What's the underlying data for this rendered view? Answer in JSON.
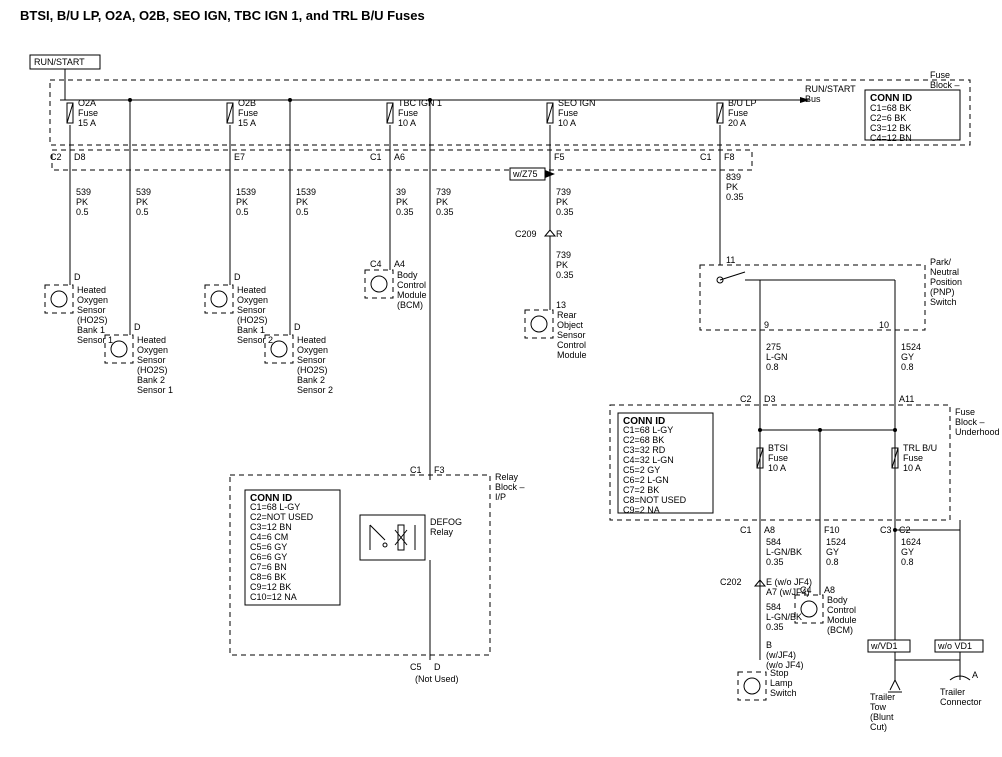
{
  "title": "BTSI, B/U LP, O2A, O2B, SEO IGN, TBC IGN 1, and TRL B/U Fuses",
  "runstart": "RUN/START",
  "runstart_bus": "RUN/START\nBus",
  "fuse_block_ip": "Fuse\nBlock –\nI/P",
  "fuse_block_uh": "Fuse\nBlock –\nUnderhood",
  "relay_block_ip": "Relay\nBlock –\nI/P",
  "fuses": {
    "o2a": {
      "name": "O2A",
      "sub": "Fuse",
      "amps": "15 A"
    },
    "o2b": {
      "name": "O2B",
      "sub": "Fuse",
      "amps": "15 A"
    },
    "tbc": {
      "name": "TBC IGN 1",
      "sub": "Fuse",
      "amps": "10 A"
    },
    "seo": {
      "name": "SEO IGN",
      "sub": "Fuse",
      "amps": "10 A"
    },
    "bulp": {
      "name": "B/U LP",
      "sub": "Fuse",
      "amps": "20 A"
    },
    "btsi": {
      "name": "BTSI",
      "sub": "Fuse",
      "amps": "10 A"
    },
    "trl": {
      "name": "TRL B/U",
      "sub": "Fuse",
      "amps": "10 A"
    }
  },
  "conn_id_ip": {
    "title": "CONN ID",
    "lines": [
      "C1=68 BK",
      "C2=6 BK",
      "C3=12 BK",
      "C4=12 BN"
    ]
  },
  "conn_id_relay": {
    "title": "CONN ID",
    "lines": [
      "C1=68 L-GY",
      "C2=NOT USED",
      "C3=12 BN",
      "C4=6 CM",
      "C5=6 GY",
      "C6=6 GY",
      "C7=6 BN",
      "C8=6 BK",
      "C9=12 BK",
      "C10=12 NA"
    ]
  },
  "conn_id_uh": {
    "title": "CONN ID",
    "lines": [
      "C1=68 L-GY",
      "C2=68 BK",
      "C3=32 RD",
      "C4=32 L-GN",
      "C5=2 GY",
      "C6=2 L-GN",
      "C7=2 BK",
      "C8=NOT USED",
      "C9=2 NA"
    ]
  },
  "wires": {
    "w1": {
      "n": "539",
      "c": "PK",
      "g": "0.5"
    },
    "w2": {
      "n": "539",
      "c": "PK",
      "g": "0.5"
    },
    "w3": {
      "n": "1539",
      "c": "PK",
      "g": "0.5"
    },
    "w4": {
      "n": "1539",
      "c": "PK",
      "g": "0.5"
    },
    "w5": {
      "n": "39",
      "c": "PK",
      "g": "0.35"
    },
    "w6": {
      "n": "739",
      "c": "PK",
      "g": "0.35"
    },
    "w7": {
      "n": "739",
      "c": "PK",
      "g": "0.35"
    },
    "w8": {
      "n": "739",
      "c": "PK",
      "g": "0.35"
    },
    "w9": {
      "n": "839",
      "c": "PK",
      "g": "0.35"
    },
    "w10": {
      "n": "275",
      "c": "L-GN",
      "g": "0.8"
    },
    "w11": {
      "n": "1524",
      "c": "GY",
      "g": "0.8"
    },
    "w12": {
      "n": "584",
      "c": "L-GN/BK",
      "g": "0.35"
    },
    "w13": {
      "n": "584",
      "c": "L-GN/BK",
      "g": "0.35"
    },
    "w14": {
      "n": "1524",
      "c": "GY",
      "g": "0.8"
    },
    "w15": {
      "n": "1624",
      "c": "GY",
      "g": "0.8"
    }
  },
  "pins": {
    "c2": "C2",
    "d8": "D8",
    "e7": "E7",
    "c1": "C1",
    "a6": "A6",
    "f5": "F5",
    "f8": "F8",
    "d": "D",
    "c4": "C4",
    "a4": "A4",
    "c209": "C209",
    "r": "R",
    "i13": "13",
    "i11": "11",
    "i9": "9",
    "i10": "10",
    "d3": "D3",
    "a11": "A11",
    "a8": "A8",
    "f10": "F10",
    "c3": "C3",
    "c202": "C202",
    "e": "E (w/o JF4)",
    "a7": "A7 (w/JF4)",
    "b": "B",
    "a": "A",
    "f3": "F3",
    "c5": "C5",
    "notused": "(Not Used)",
    "wjf4": "(w/JF4)",
    "wojf4": "(w/o JF4)"
  },
  "z75": "w/Z75",
  "vd1_w": "w/VD1",
  "vd1_wo": "w/o VD1",
  "components": {
    "ho2s_b1s1": "Heated\nOxygen\nSensor\n(HO2S)\nBank 1\nSensor 1",
    "ho2s_b2s1": "Heated\nOxygen\nSensor\n(HO2S)\nBank 2\nSensor 1",
    "ho2s_b1s2": "Heated\nOxygen\nSensor\n(HO2S)\nBank 1\nSensor 2",
    "ho2s_b2s2": "Heated\nOxygen\nSensor\n(HO2S)\nBank 2\nSensor 2",
    "bcm": "Body\nControl\nModule\n(BCM)",
    "bcm2": "Body\nControl\nModule\n(BCM)",
    "rosc": "Rear\nObject\nSensor\nControl\nModule",
    "pnp": "Park/\nNeutral\nPosition\n(PNP)\nSwitch",
    "defog": "DEFOG\nRelay",
    "stop": "Stop\nLamp\nSwitch",
    "tow": "Trailer\nTow\n(Blunt\nCut)",
    "conn": "Trailer\nConnector"
  }
}
